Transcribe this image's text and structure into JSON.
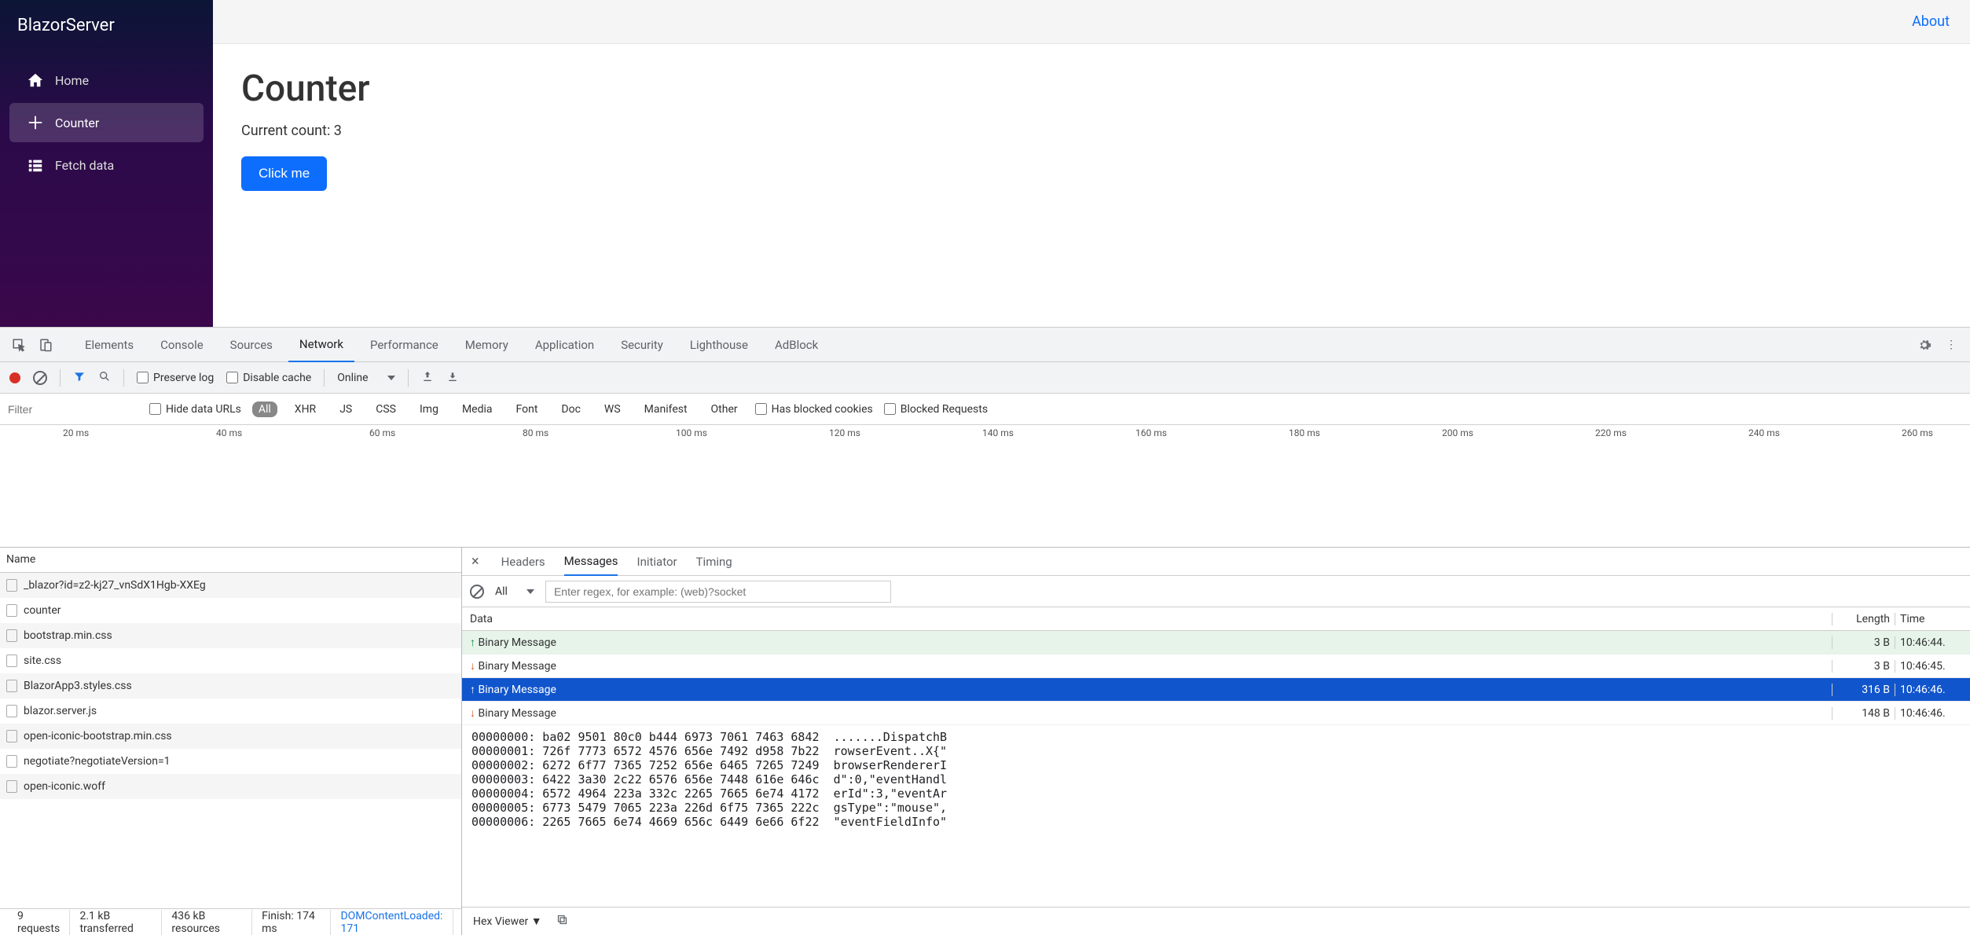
{
  "app": {
    "brand": "BlazorServer",
    "nav": [
      {
        "label": "Home",
        "icon": "home",
        "active": false
      },
      {
        "label": "Counter",
        "icon": "plus",
        "active": true
      },
      {
        "label": "Fetch data",
        "icon": "list",
        "active": false
      }
    ],
    "topbar_link": "About",
    "page_title": "Counter",
    "count_label": "Current count: 3",
    "button": "Click me"
  },
  "devtools": {
    "main_tabs": [
      "Elements",
      "Console",
      "Sources",
      "Network",
      "Performance",
      "Memory",
      "Application",
      "Security",
      "Lighthouse",
      "AdBlock"
    ],
    "main_tab_active": "Network",
    "toolbar": {
      "preserve_log": "Preserve log",
      "disable_cache": "Disable cache",
      "throttling": "Online"
    },
    "filter": {
      "placeholder": "Filter",
      "hide_data_urls": "Hide data URLs",
      "types": [
        "All",
        "XHR",
        "JS",
        "CSS",
        "Img",
        "Media",
        "Font",
        "Doc",
        "WS",
        "Manifest",
        "Other"
      ],
      "type_active": "All",
      "has_blocked_cookies": "Has blocked cookies",
      "blocked_requests": "Blocked Requests"
    },
    "timeline_ticks": [
      "20 ms",
      "40 ms",
      "60 ms",
      "80 ms",
      "100 ms",
      "120 ms",
      "140 ms",
      "160 ms",
      "180 ms",
      "200 ms",
      "220 ms",
      "240 ms",
      "260 ms"
    ],
    "requests_header": "Name",
    "requests": [
      "_blazor?id=z2-kj27_vnSdX1Hgb-XXEg",
      "counter",
      "bootstrap.min.css",
      "site.css",
      "BlazorApp3.styles.css",
      "blazor.server.js",
      "open-iconic-bootstrap.min.css",
      "negotiate?negotiateVersion=1",
      "open-iconic.woff"
    ],
    "detail_tabs": [
      "Headers",
      "Messages",
      "Initiator",
      "Timing"
    ],
    "detail_tab_active": "Messages",
    "msg_filter_all": "All",
    "msg_filter_placeholder": "Enter regex, for example: (web)?socket",
    "msg_cols": {
      "data": "Data",
      "length": "Length",
      "time": "Time"
    },
    "messages": [
      {
        "dir": "up",
        "text": "Binary Message",
        "len": "3 B",
        "time": "10:46:44.",
        "selected": false
      },
      {
        "dir": "down",
        "text": "Binary Message",
        "len": "3 B",
        "time": "10:46:45.",
        "selected": false
      },
      {
        "dir": "up",
        "text": "Binary Message",
        "len": "316 B",
        "time": "10:46:46.",
        "selected": true
      },
      {
        "dir": "down",
        "text": "Binary Message",
        "len": "148 B",
        "time": "10:46:46.",
        "selected": false
      }
    ],
    "hex_lines": [
      "00000000: ba02 9501 80c0 b444 6973 7061 7463 6842  .......DispatchB",
      "00000001: 726f 7773 6572 4576 656e 7492 d958 7b22  rowserEvent..X{\"",
      "00000002: 6272 6f77 7365 7252 656e 6465 7265 7249  browserRendererI",
      "00000003: 6422 3a30 2c22 6576 656e 7448 616e 646c  d\":0,\"eventHandl",
      "00000004: 6572 4964 223a 332c 2265 7665 6e74 4172  erId\":3,\"eventAr",
      "00000005: 6773 5479 7065 223a 226d 6f75 7365 222c  gsType\":\"mouse\",",
      "00000006: 2265 7665 6e74 4669 656c 6449 6e66 6f22  \"eventFieldInfo\""
    ],
    "hex_footer": "Hex Viewer ▼",
    "status": {
      "requests": "9 requests",
      "transferred": "2.1 kB transferred",
      "resources": "436 kB resources",
      "finish": "Finish: 174 ms",
      "dom": "DOMContentLoaded: 171"
    }
  }
}
